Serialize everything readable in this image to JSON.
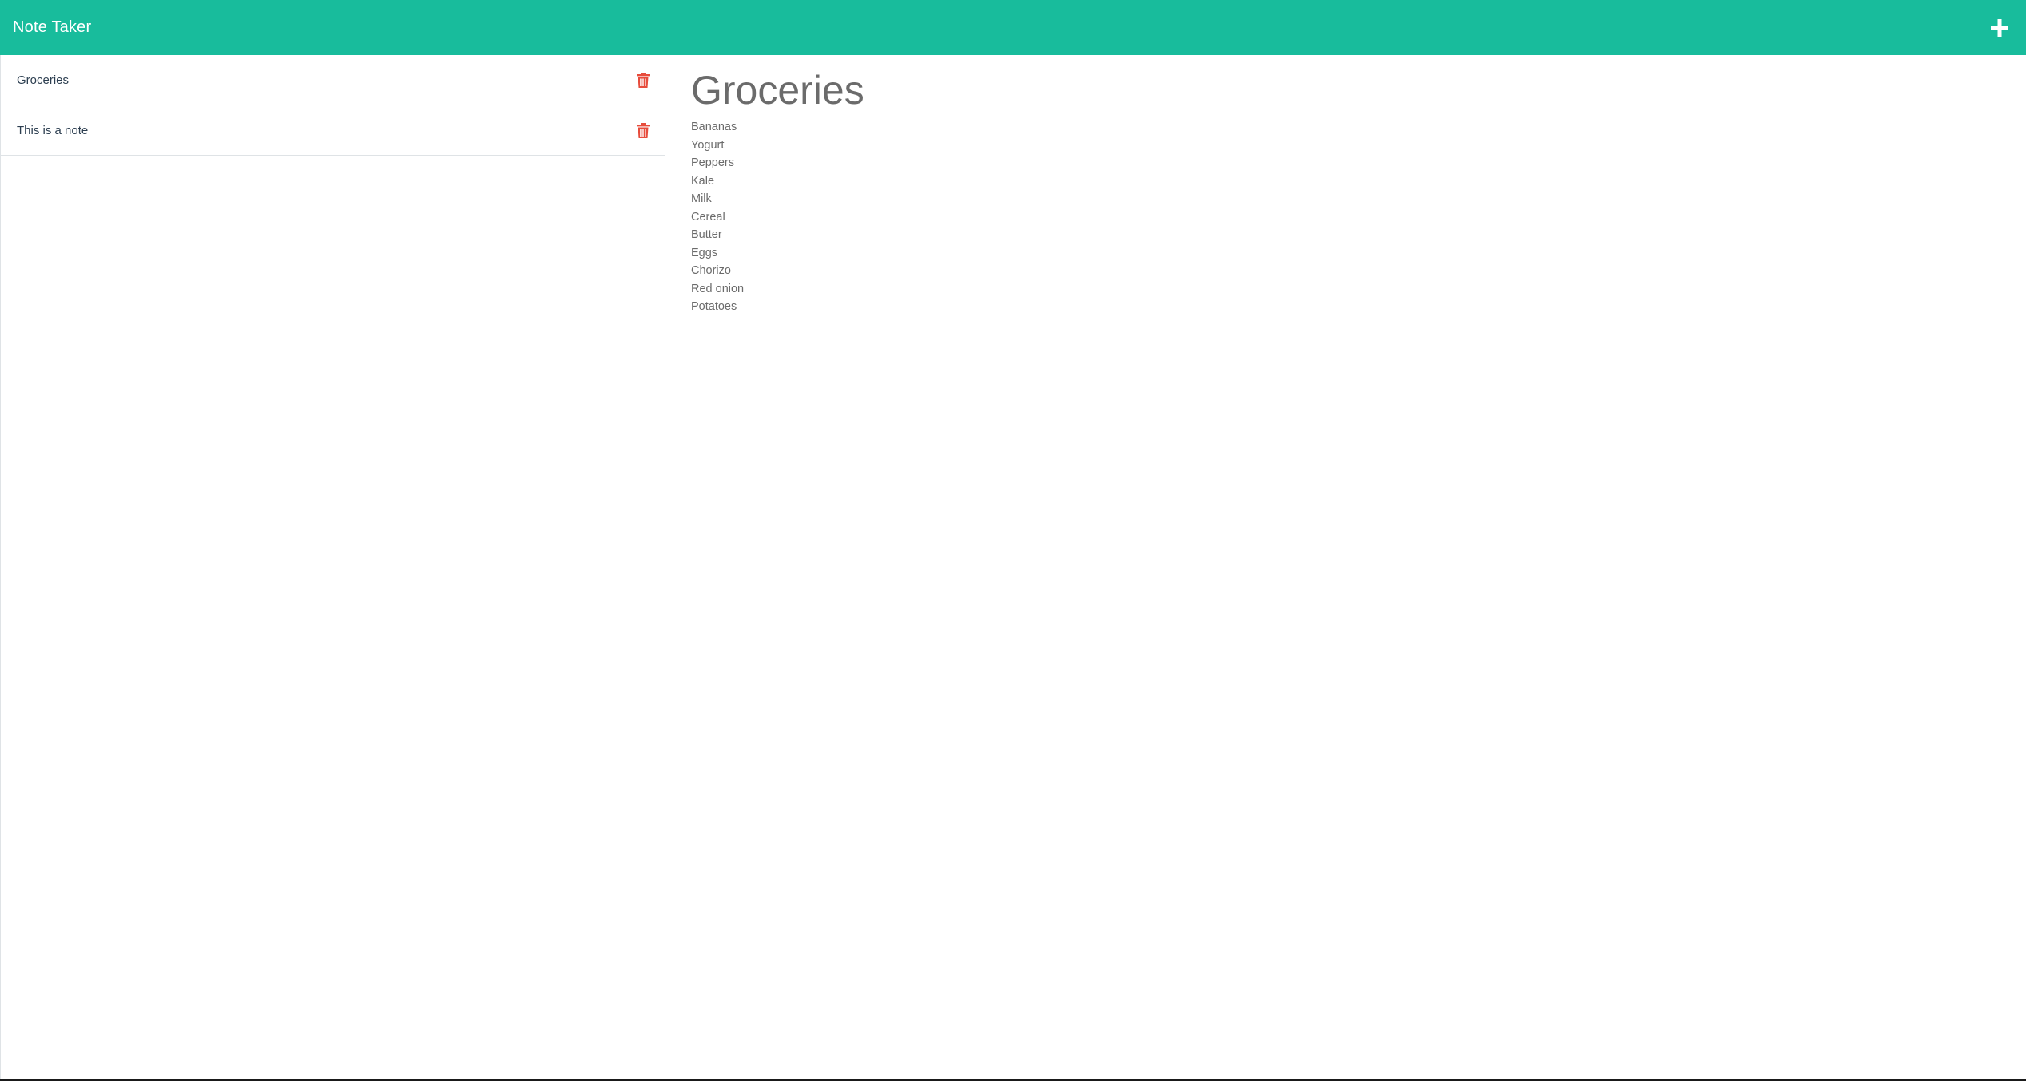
{
  "app": {
    "title": "Note Taker"
  },
  "header": {
    "new_note_icon": "plus-icon"
  },
  "notes": [
    {
      "title": "Groceries",
      "delete_icon": "trash-icon"
    },
    {
      "title": "This is a note",
      "delete_icon": "trash-icon"
    }
  ],
  "active_note": {
    "title": "Groceries",
    "lines": [
      "Bananas",
      "Yogurt",
      "Peppers",
      "Kale",
      "Milk",
      "Cereal",
      "Butter",
      "Eggs",
      "Chorizo",
      "Red onion",
      "Potatoes"
    ]
  },
  "colors": {
    "accent": "#18bc9c",
    "delete": "#e74c3c"
  }
}
